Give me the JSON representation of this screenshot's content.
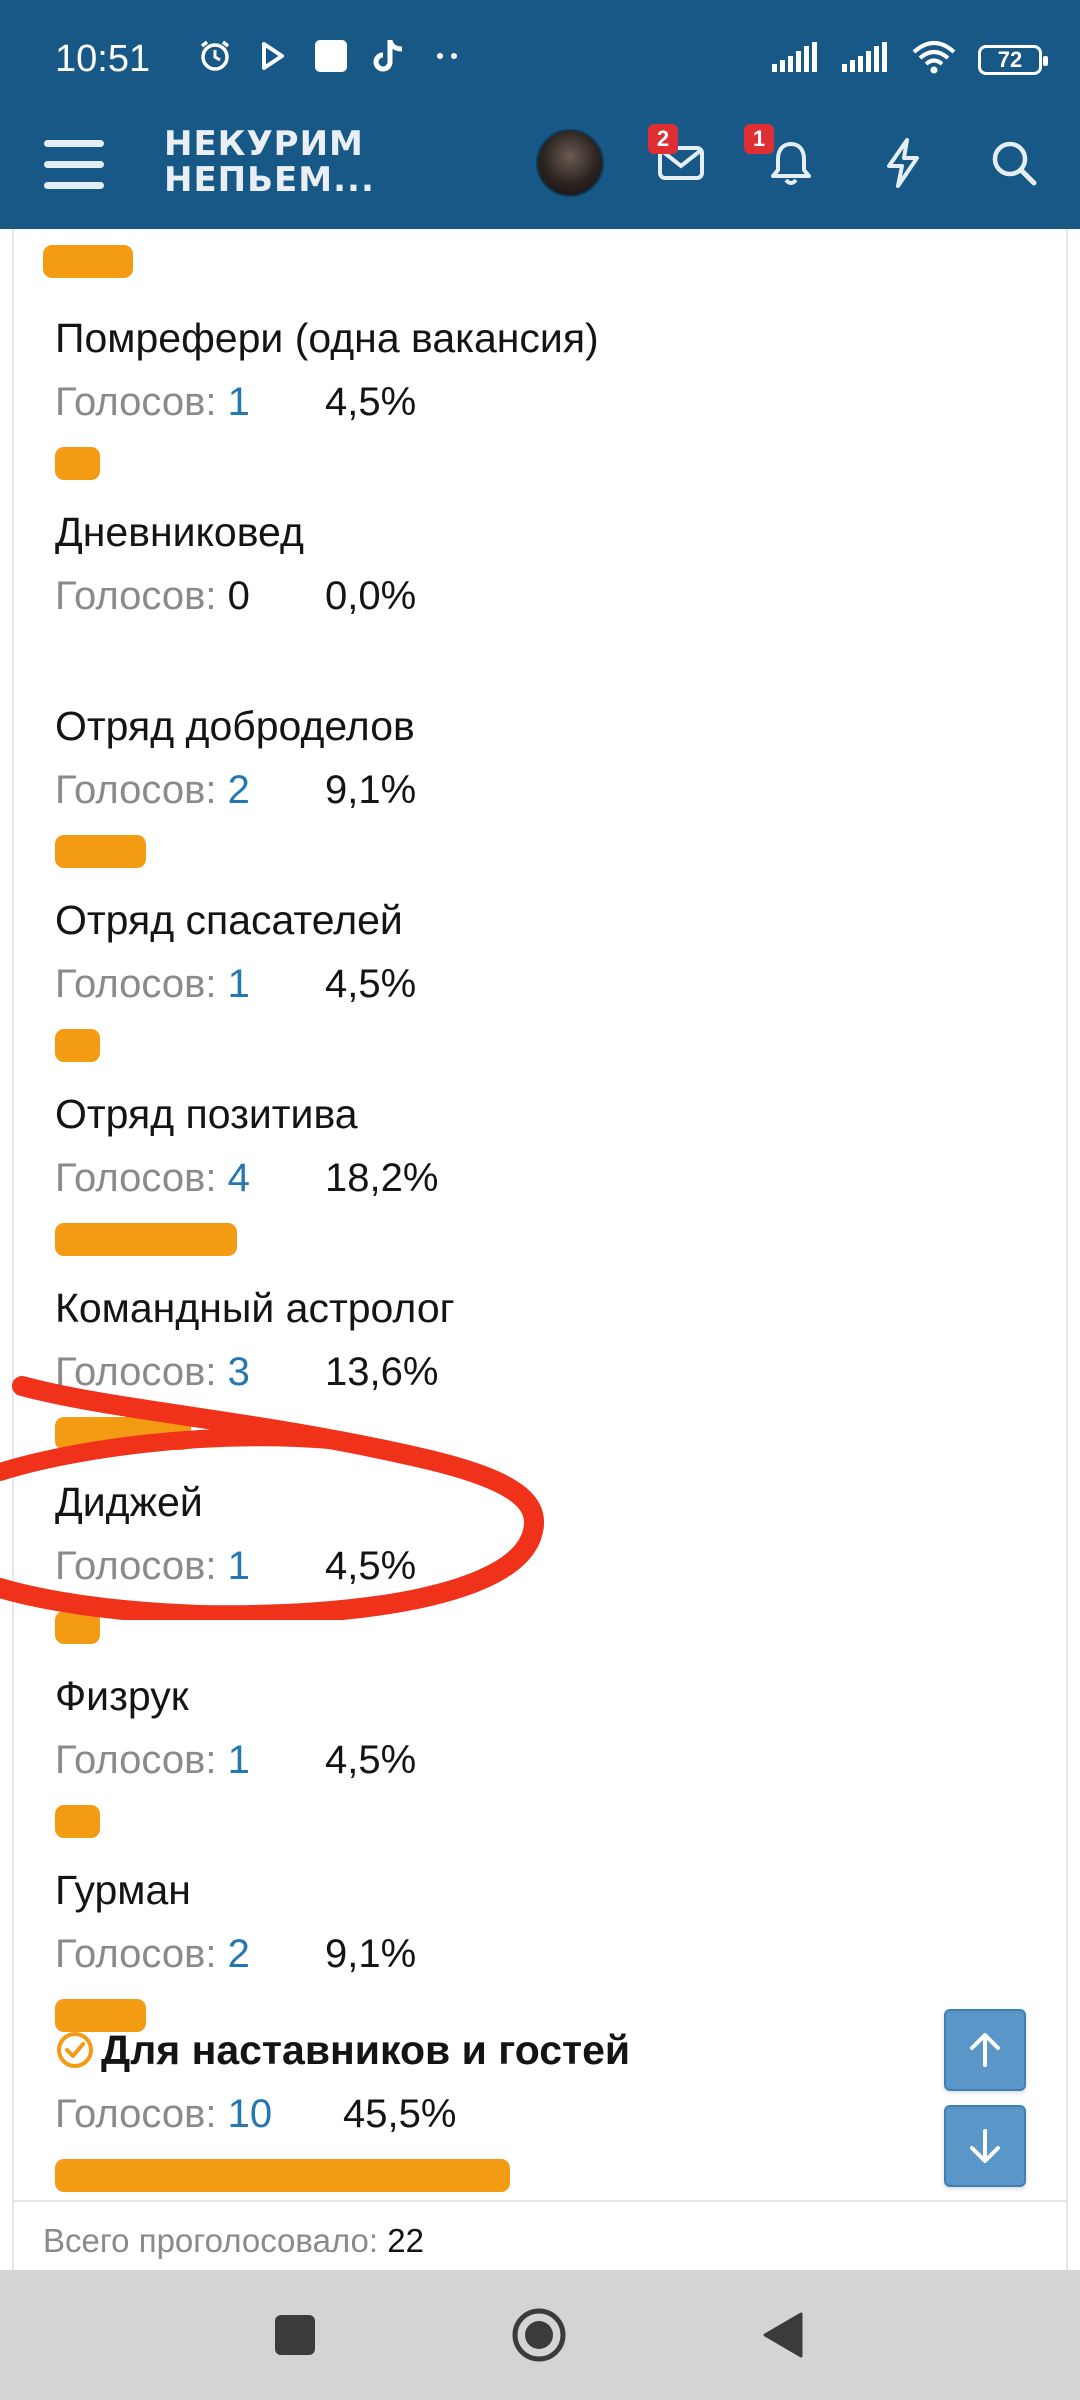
{
  "status_bar": {
    "time": "10:51",
    "battery": "72",
    "icons_left": [
      "alarm-icon",
      "play-icon",
      "square-notification-icon",
      "tiktok-icon",
      "more-dots-icon"
    ],
    "icons_right": [
      "signal-icon",
      "signal-icon",
      "wifi-icon",
      "battery-icon"
    ]
  },
  "header": {
    "logo_line1": "НЕКУРИМ",
    "logo_line2": "НЕПЬЕМ...",
    "messages_badge": "2",
    "alerts_badge": "1",
    "icons": [
      "menu-icon",
      "avatar",
      "envelope-icon",
      "bell-icon",
      "lightning-icon",
      "search-icon"
    ]
  },
  "poll": {
    "vote_label": "Голосов:",
    "options": [
      {
        "name": "Помрефери (одна вакансия)",
        "votes": "1",
        "percent": "4,5%",
        "share": 4.5
      },
      {
        "name": "Дневниковед",
        "votes": "0",
        "percent": "0,0%",
        "share": 0
      },
      {
        "name": "Отряд доброделов",
        "votes": "2",
        "percent": "9,1%",
        "share": 9.1
      },
      {
        "name": "Отряд спасателей",
        "votes": "1",
        "percent": "4,5%",
        "share": 4.5
      },
      {
        "name": "Отряд позитива",
        "votes": "4",
        "percent": "18,2%",
        "share": 18.2
      },
      {
        "name": "Командный астролог",
        "votes": "3",
        "percent": "13,6%",
        "share": 13.6
      },
      {
        "name": "Диджей",
        "votes": "1",
        "percent": "4,5%",
        "share": 4.5
      },
      {
        "name": "Физрук",
        "votes": "1",
        "percent": "4,5%",
        "share": 4.5
      },
      {
        "name": "Гурман",
        "votes": "2",
        "percent": "9,1%",
        "share": 9.1
      },
      {
        "name": "Для наставников и гостей",
        "votes": "10",
        "percent": "45,5%",
        "share": 45.5,
        "selected": true
      }
    ],
    "total_label": "Всего проголосовало:",
    "total_value": "22"
  },
  "colors": {
    "header_bg": "#185886",
    "bar": "#f39b12",
    "vote_count": "#2577b1",
    "badge": "#df2f35",
    "scroll_button": "#5a97c8",
    "annotation": "#f0321a"
  }
}
